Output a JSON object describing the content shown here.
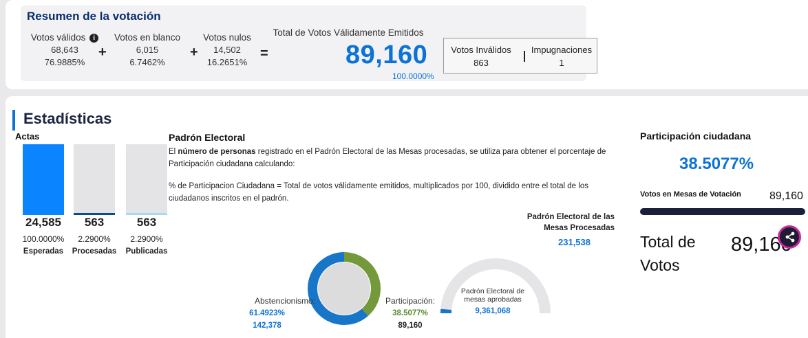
{
  "summary": {
    "title": "Resumen de la votación",
    "validos": {
      "label": "Votos válidos",
      "value": "68,643",
      "pct": "76.9885%"
    },
    "blanco": {
      "label": "Votos en blanco",
      "value": "6,015",
      "pct": "6.7462%"
    },
    "nulos": {
      "label": "Votos nulos",
      "value": "14,502",
      "pct": "16.2651%"
    },
    "ops": {
      "plus": "+",
      "equals": "="
    },
    "total": {
      "label": "Total de Votos Válidamente Emitidos",
      "value": "89,160",
      "pct": "100.0000%"
    },
    "invalidos": {
      "label": "Votos Inválidos",
      "value": "863"
    },
    "impugnaciones": {
      "label": "Impugnaciones",
      "value": "1"
    }
  },
  "stats": {
    "title": "Estadísticas",
    "actas": {
      "label": "Actas",
      "items": [
        {
          "value": "24,585",
          "pct": "100.0000%",
          "name": "Esperadas",
          "fill": 1.0,
          "color": "#0a84ff"
        },
        {
          "value": "563",
          "pct": "2.2900%",
          "name": "Procesadas",
          "fill": 0.029,
          "color": "#0b4e86"
        },
        {
          "value": "563",
          "pct": "2.2900%",
          "name": "Publicadas",
          "fill": 0.029,
          "color": "#aad8ef"
        }
      ]
    },
    "padron": {
      "title": "Padrón Electoral",
      "text_pre": "El ",
      "text_bold": "número de personas",
      "text_post": " registrado en el Padrón Electoral de las Mesas procesadas, se utiliza para obtener el porcentaje de Participación ciudadana calculando:",
      "formula": "% de Participacion Ciudadana = Total de votos válidamente emitidos, multiplicados por 100, dividido entre el total de los ciudadanos inscritos en el padrón.",
      "mesas_label": "Padrón Electoral de las Mesas Procesadas",
      "mesas_value": "231,538",
      "abstencionismo": {
        "label": "Abstencionismo:",
        "pct": "61.4923%",
        "value": "142,378",
        "fraction": 0.614923
      },
      "participacion": {
        "label": "Participación:",
        "pct": "38.5077%",
        "value": "89,160",
        "fraction": 0.385077
      },
      "gauge": {
        "label": "Padrón Electoral de mesas aprobadas",
        "value": "9,361,068",
        "fraction": 0.025
      }
    },
    "participacion_ciudadana": {
      "title": "Participación ciudadana",
      "pct": "38.5077%",
      "votos_mesas_label": "Votos en Mesas de Votación",
      "votos_mesas_value": "89,160",
      "total_label": "Total de Votos",
      "total_value": "89,160"
    }
  },
  "colors": {
    "accent_blue": "#0d72d6",
    "abstencion": "#1876c9",
    "participacion": "#73993a",
    "dark_navy": "#1c1f3a"
  },
  "icons": {
    "info": "info-icon",
    "share": "share-icon"
  }
}
